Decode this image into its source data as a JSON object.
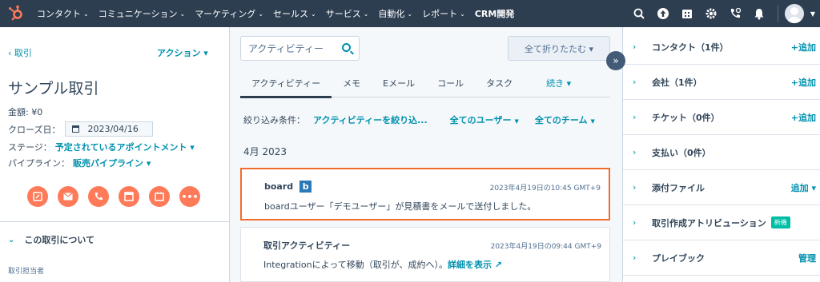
{
  "topnav": {
    "items": [
      {
        "label": "コンタクト",
        "chev": "⌄"
      },
      {
        "label": "コミュニケーション",
        "chev": "⌄"
      },
      {
        "label": "マーケティング",
        "chev": "⌄"
      },
      {
        "label": "セールス",
        "chev": "⌄"
      },
      {
        "label": "サービス",
        "chev": "⌄"
      },
      {
        "label": "自動化",
        "chev": "⌄"
      },
      {
        "label": "レポート",
        "chev": "⌄"
      },
      {
        "label": "CRM開発",
        "chev": ""
      }
    ]
  },
  "left": {
    "back": "‹ 取引",
    "actions": "アクション ▾",
    "title": "サンプル取引",
    "amount_label": "金額: ¥0",
    "close_label": "クローズ日：",
    "close_date": "2023/04/16",
    "stage_label": "ステージ：",
    "stage_value": "予定されているアポイントメント ▾",
    "pipeline_label": "パイプライン：",
    "pipeline_value": "販売パイプライン ▾",
    "about": "この取引について",
    "owner_label": "取引担当者"
  },
  "middle": {
    "search_placeholder": "アクティビティー",
    "collapse": "全て折りたたむ ▾",
    "tabs": [
      "アクティビティー",
      "メモ",
      "Eメール",
      "コール",
      "タスク"
    ],
    "more_tab": "続き ▾",
    "filter_label": "絞り込み条件：",
    "filter_activity": "アクティビティーを絞り込...",
    "filter_users": "全てのユーザー",
    "filter_teams": "全てのチーム",
    "month": "4月 2023",
    "card1": {
      "title": "board",
      "logo": "b",
      "time": "2023年4月19日の10:45 GMT+9",
      "body": "boardユーザー「デモユーザー」が見積書をメールで送付しました。"
    },
    "card2": {
      "title": "取引アクティビティー",
      "time": "2023年4月19日の09:44 GMT+9",
      "body": "Integrationによって移動（取引が、成約へ）。",
      "link": "詳細を表示 ↗"
    }
  },
  "right": {
    "rows": [
      {
        "label": "コンタクト（1件）",
        "action": "+追加"
      },
      {
        "label": "会社（1件）",
        "action": "+追加"
      },
      {
        "label": "チケット（0件）",
        "action": "+追加"
      },
      {
        "label": "支払い（0件）",
        "action": ""
      },
      {
        "label": "添付ファイル",
        "action": "追加 ▾"
      },
      {
        "label": "取引作成アトリビューション",
        "action": "",
        "badge": "新機"
      },
      {
        "label": "プレイブック",
        "action": "管理"
      }
    ]
  },
  "colors": {
    "nav": "#2d3e50",
    "accent": "#0091ae",
    "orange": "#ff7a59",
    "highlight": "#f26c2b"
  }
}
